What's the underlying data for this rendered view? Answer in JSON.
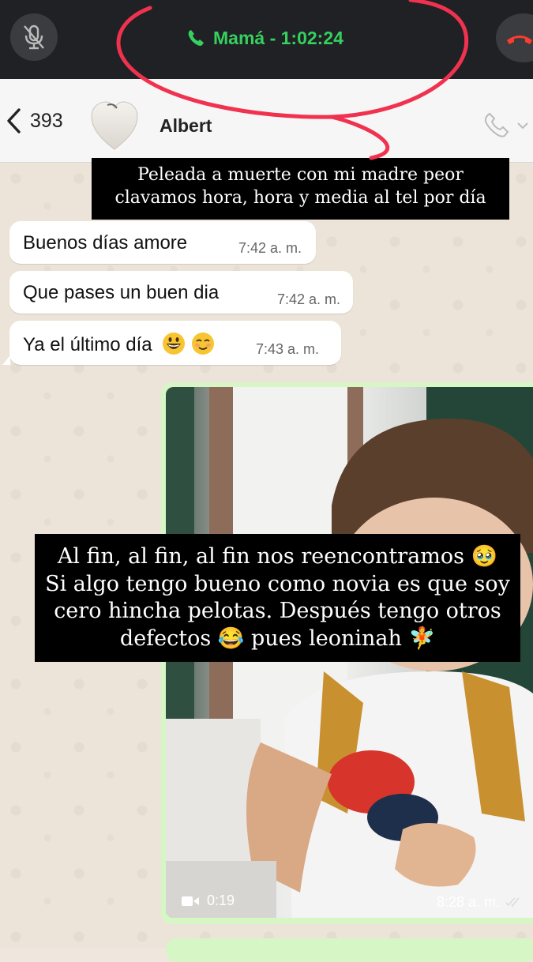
{
  "call_banner": {
    "title": "Mamá - 1:02:24",
    "accent_color": "#35d05e",
    "end_color": "#ff3b30",
    "mute_icon": "mic-off-icon",
    "end_icon": "phone-hangup-icon"
  },
  "chat_header": {
    "back_count": "393",
    "contact_name": "Albert",
    "call_icon": "phone-icon"
  },
  "overlay_captions": {
    "top": [
      "Peleada a muerte con mi madre peor",
      "clavamos hora, hora y media al tel por día"
    ],
    "middle": [
      "Al fin, al fin, al fin nos reencontramos 🥹",
      "Si algo tengo bueno como novia es que soy",
      "cero hincha pelotas. Después tengo otros",
      "defectos 😂 pues leoninah 🧚"
    ]
  },
  "messages": [
    {
      "text": "Buenos días amore",
      "time": "7:42 a. m."
    },
    {
      "text": "Que pases un buen dia",
      "time": "7:42 a. m."
    },
    {
      "text": "Ya el último día",
      "time": "7:43 a. m.",
      "emojis": [
        "grinning-face",
        "smiling-face"
      ]
    }
  ],
  "video_message": {
    "duration": "0:19",
    "time": "8:28 a. m.",
    "bubble_color": "#d7f6c6"
  }
}
